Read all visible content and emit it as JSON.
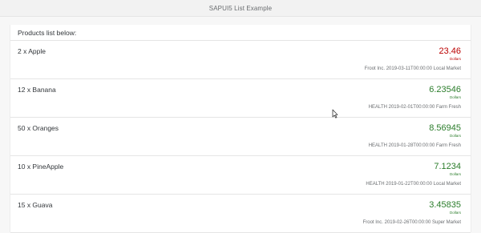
{
  "app": {
    "title": "SAPUI5 List Example"
  },
  "list": {
    "header": "Products list below:",
    "items": [
      {
        "title": "2 x Apple",
        "number": "23.46",
        "unit": "Dollars",
        "attribute": "Froot Inc. 2019-03-11T00:00:00 Local Market",
        "state": "error"
      },
      {
        "title": "12 x Banana",
        "number": "6.23546",
        "unit": "Dollars",
        "attribute": "HEALTH 2019-02-01T00:00:00 Farm Fresh",
        "state": "success"
      },
      {
        "title": "50 x Oranges",
        "number": "8.56945",
        "unit": "Dollars",
        "attribute": "HEALTH 2019-01-28T00:00:00 Farm Fresh",
        "state": "success"
      },
      {
        "title": "10 x PineApple",
        "number": "7.1234",
        "unit": "Dollars",
        "attribute": "HEALTH 2019-01-22T00:00:00 Local Market",
        "state": "success"
      },
      {
        "title": "15 x Guava",
        "number": "3.45835",
        "unit": "Dollars",
        "attribute": "Froot Inc. 2019-02-26T00:00:00 Super Market",
        "state": "success"
      }
    ]
  },
  "colors": {
    "error": "#bb0000",
    "success": "#2b7d2b"
  },
  "cursor": {
    "icon": "mouse-pointer-icon"
  }
}
